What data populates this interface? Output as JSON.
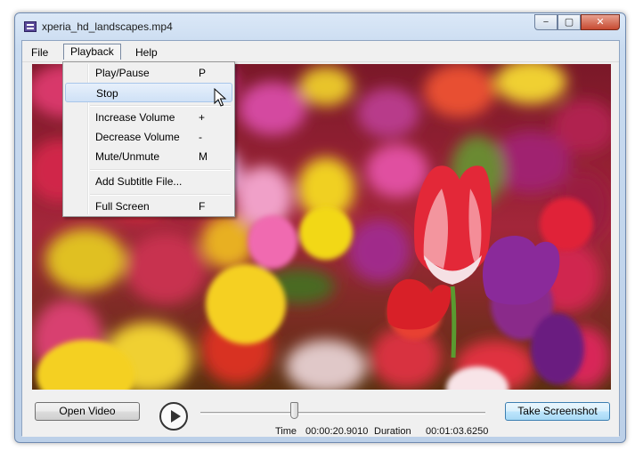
{
  "window": {
    "title": "xperia_hd_landscapes.mp4"
  },
  "caption": {
    "minimize": "−",
    "maximize": "▢",
    "close": "✕"
  },
  "menubar": {
    "items": [
      {
        "label": "File"
      },
      {
        "label": "Playback",
        "active": true
      },
      {
        "label": "Help"
      }
    ]
  },
  "playback_menu": {
    "items": [
      {
        "label": "Play/Pause",
        "shortcut": "P"
      },
      {
        "label": "Stop",
        "shortcut": "",
        "highlighted": true
      },
      {
        "label": "Increase Volume",
        "shortcut": "+"
      },
      {
        "label": "Decrease Volume",
        "shortcut": "-"
      },
      {
        "label": "Mute/Unmute",
        "shortcut": "M"
      },
      {
        "label": "Add Subtitle File...",
        "shortcut": ""
      },
      {
        "label": "Full Screen",
        "shortcut": "F"
      }
    ]
  },
  "controls": {
    "open_video_label": "Open Video",
    "take_screenshot_label": "Take Screenshot",
    "time_label": "Time",
    "time_value": "00:00:20.9010",
    "duration_label": "Duration",
    "duration_value": "00:01:03.6250",
    "seek_fraction": 0.329
  },
  "video": {
    "description_icon": "tulip-field-video-frame"
  }
}
